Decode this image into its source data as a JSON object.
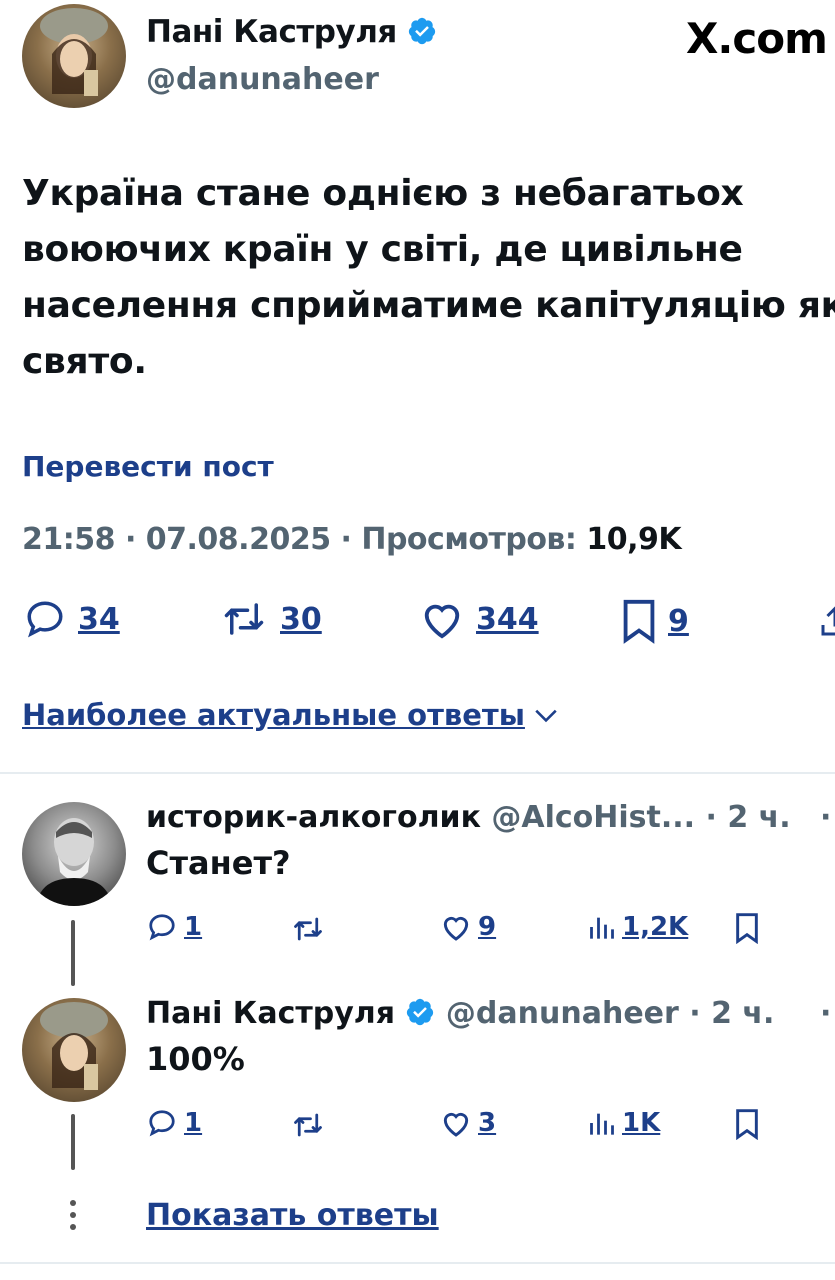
{
  "post": {
    "author_name": "Пані Каструля",
    "author_handle": "@danunaheer",
    "site": "X.com",
    "text_lines": [
      "Україна стане однією з небагатьох",
      "воюючих країн у світі, де цивільне",
      "населення сприйматиме капітуляцію як",
      "свято."
    ],
    "translate": "Перевести пост",
    "time": "21:58 · 07.08.2025 · Просмотров:",
    "views": "10,9K",
    "replies": "34",
    "reposts": "30",
    "likes": "344",
    "bookmarks": "9"
  },
  "sort_label": "Наиболее актуальные ответы",
  "replies": [
    {
      "name": "историк-алкоголик",
      "handle": "@AlcoHist...",
      "time": "· 2 ч.",
      "text": "Станет?",
      "replies": "1",
      "likes": "9",
      "views": "1,2K"
    },
    {
      "name": "Пані Каструля",
      "handle": "@danunaheer",
      "time": "· 2 ч.",
      "text": "100%",
      "replies": "1",
      "likes": "3",
      "views": "1K"
    }
  ],
  "show_replies": "Показать ответы",
  "colors": {
    "verified": "#1d9bf0",
    "link": "#1d3f8a",
    "muted": "#536471"
  }
}
